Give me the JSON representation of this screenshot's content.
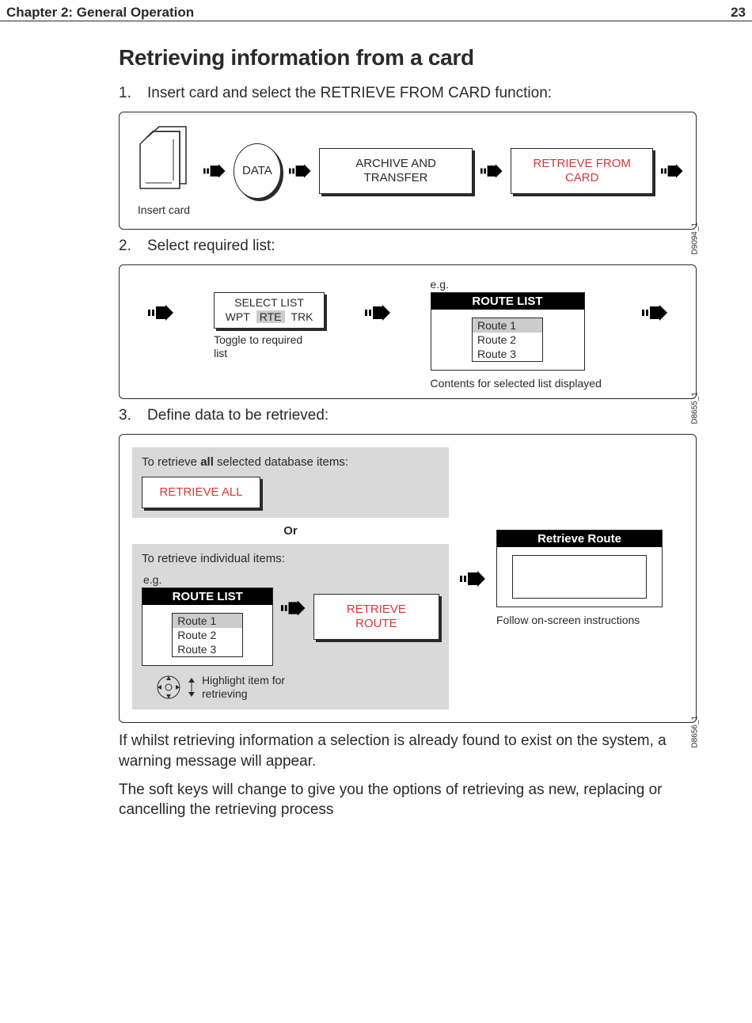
{
  "header": {
    "chapter": "Chapter 2: General Operation",
    "page": "23"
  },
  "section_title": "Retrieving information from a card",
  "steps": {
    "s1": {
      "num": "1.",
      "text": "Insert card and select the RETRIEVE FROM CARD function:"
    },
    "s2": {
      "num": "2.",
      "text": "Select required list:"
    },
    "s3": {
      "num": "3.",
      "text": "Define data to be retrieved:"
    }
  },
  "panel1": {
    "insert_card": "Insert card",
    "data_btn": "DATA",
    "archive_btn": "ARCHIVE AND TRANSFER",
    "retrieve_btn": "RETRIEVE FROM CARD",
    "figref": "D9094_1"
  },
  "panel2": {
    "select_title": "SELECT LIST",
    "tabs": {
      "wpt": "WPT",
      "rte": "RTE",
      "trk": "TRK"
    },
    "toggle_caption": "Toggle to required list",
    "eg": "e.g.",
    "route_list_title": "ROUTE LIST",
    "routes": {
      "r1": "Route 1",
      "r2": "Route 2",
      "r3": "Route 3"
    },
    "contents_caption": "Contents for selected list displayed",
    "figref": "D8655_1"
  },
  "panel3": {
    "all_label_pre": "To retrieve ",
    "all_label_bold": "all",
    "all_label_post": " selected database items:",
    "retrieve_all_btn": "RETRIEVE ALL",
    "or": "Or",
    "indiv_label": "To retrieve individual items:",
    "eg": "e.g.",
    "route_list_title": "ROUTE LIST",
    "routes": {
      "r1": "Route 1",
      "r2": "Route 2",
      "r3": "Route 3"
    },
    "retrieve_route_btn": "RETRIEVE ROUTE",
    "highlight_caption": "Highlight item for retrieving",
    "retrieve_route_title": "Retrieve Route",
    "follow_caption": "Follow on-screen instructions",
    "figref": "D8656_1"
  },
  "body": {
    "p1": "If whilst retrieving information a selection is already found to exist on the system, a warning message will appear.",
    "p2": "The soft keys will change to give you the options of retrieving as new, replacing or cancelling the retrieving process"
  }
}
